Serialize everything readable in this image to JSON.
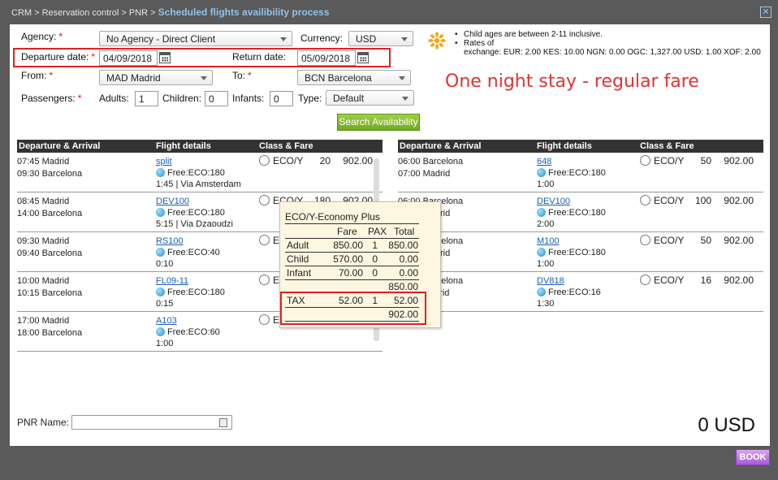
{
  "breadcrumb": {
    "path": "CRM > Reservation control > PNR >",
    "current": "Scheduled flights availibility process"
  },
  "form": {
    "agency_label": "Agency:",
    "agency_value": "No Agency - Direct Client",
    "currency_label": "Currency:",
    "currency_value": "USD",
    "departure_label": "Departure date:",
    "departure_value": "04/09/2018",
    "return_label": "Return date:",
    "return_value": "05/09/2018",
    "from_label": "From:",
    "from_value": "MAD  Madrid",
    "to_label": "To:",
    "to_value": "BCN  Barcelona",
    "passengers_label": "Passengers:",
    "adults_label": "Adults:",
    "adults_value": "1",
    "children_label": "Children:",
    "children_value": "0",
    "infants_label": "Infants:",
    "infants_value": "0",
    "type_label": "Type:",
    "type_value": "Default",
    "search_button": "Search Availability"
  },
  "info": {
    "line1": "Child ages are between 2-11 inclusive.",
    "line2": "Rates of",
    "line3": "exchange: EUR: 2.00  KES: 10.00  NGN: 0.00  OGC: 1,327.00  USD: 1.00  XOF: 2.00"
  },
  "annotation": "One night stay - regular fare",
  "table_headers": {
    "col1": "Departure & Arrival",
    "col2": "Flight details",
    "col3": "Class & Fare"
  },
  "outbound": [
    {
      "dep": "07:45 Madrid",
      "arr": "09:30 Barcelona",
      "flight": "split",
      "free": "Free:ECO:180",
      "dur": "1:45 | Via Amsterdam",
      "cls": "ECO/Y",
      "seats": "20",
      "fare": "902.00"
    },
    {
      "dep": "08:45 Madrid",
      "arr": "14:00 Barcelona",
      "flight": "DEV100",
      "free": "Free:ECO:180",
      "dur": "5:15 | Via Dzaoudzi",
      "cls": "ECO/Y",
      "seats": "180",
      "fare": "902.00"
    },
    {
      "dep": "09:30 Madrid",
      "arr": "09:40 Barcelona",
      "flight": "RS100",
      "free": "Free:ECO:40",
      "dur": "0:10",
      "cls": "ECO/Y",
      "seats": "",
      "fare": ""
    },
    {
      "dep": "10:00 Madrid",
      "arr": "10:15 Barcelona",
      "flight": "FL09-11",
      "free": "Free:ECO:180",
      "dur": "0:15",
      "cls": "ECO/Y",
      "seats": "",
      "fare": ""
    },
    {
      "dep": "17:00 Madrid",
      "arr": "18:00 Barcelona",
      "flight": "A103",
      "free": "Free:ECO:60",
      "dur": "1:00",
      "cls": "ECO/Y",
      "seats": "",
      "fare": ""
    }
  ],
  "return": [
    {
      "dep": "06:00 Barcelona",
      "arr": "07:00 Madrid",
      "flight": "648",
      "free": "Free:ECO:180",
      "dur": "1:00",
      "cls": "ECO/Y",
      "seats": "50",
      "fare": "902.00"
    },
    {
      "dep": "06:00 Barcelona",
      "arr": "08:00 Madrid",
      "flight": "DEV100",
      "free": "Free:ECO:180",
      "dur": "2:00",
      "cls": "ECO/Y",
      "seats": "100",
      "fare": "902.00"
    },
    {
      "dep": "08:00 Barcelona",
      "arr": "09:00 Madrid",
      "flight": "M100",
      "free": "Free:ECO:180",
      "dur": "1:00",
      "cls": "ECO/Y",
      "seats": "50",
      "fare": "902.00"
    },
    {
      "dep": "09:30 Barcelona",
      "arr": "11:00 Madrid",
      "flight": "DV818",
      "free": "Free:ECO:16",
      "dur": "1:30",
      "cls": "ECO/Y",
      "seats": "16",
      "fare": "902.00"
    }
  ],
  "popup": {
    "title": "ECO/Y-Economy Plus",
    "headers": {
      "fare": "Fare",
      "pax": "PAX",
      "total": "Total"
    },
    "rows": [
      {
        "label": "Adult",
        "fare": "850.00",
        "pax": "1",
        "total": "850.00"
      },
      {
        "label": "Child",
        "fare": "570.00",
        "pax": "0",
        "total": "0.00"
      },
      {
        "label": "Infant",
        "fare": "70.00",
        "pax": "0",
        "total": "0.00"
      }
    ],
    "subtotal": "850.00",
    "tax": {
      "label": "TAX",
      "fare": "52.00",
      "pax": "1",
      "total": "52.00"
    },
    "grand_total": "902.00"
  },
  "pnr_label": "PNR Name:",
  "total": "0 USD",
  "book_button": "BOOK",
  "close_icon": "close-icon"
}
